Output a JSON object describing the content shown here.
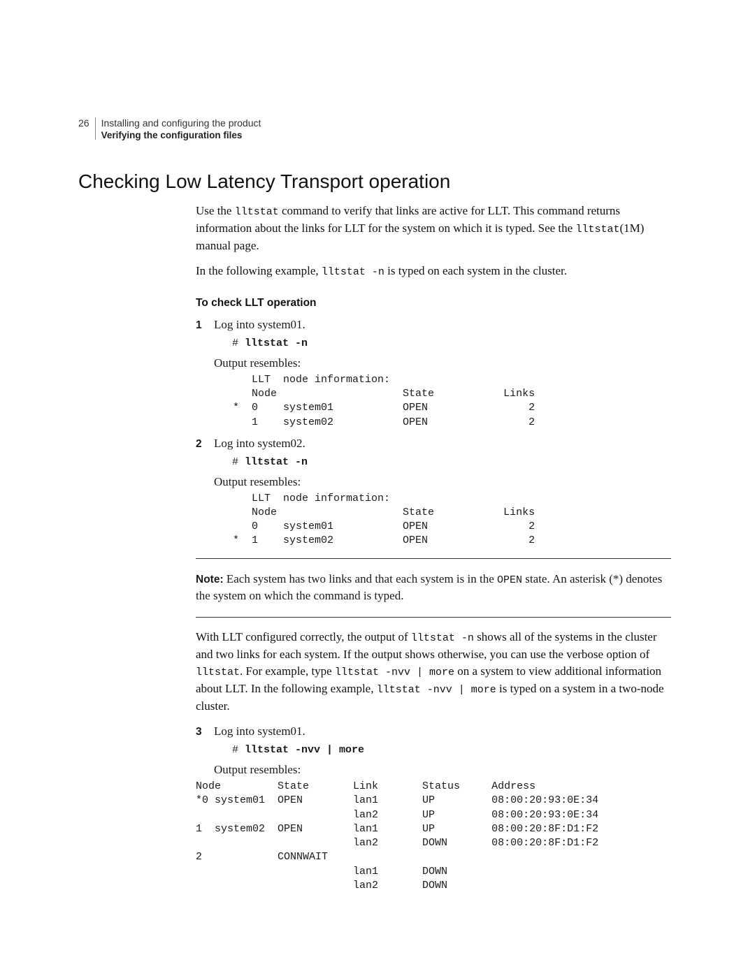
{
  "header": {
    "page_number": "26",
    "line1": "Installing and configuring the product",
    "line2": "Verifying the configuration files"
  },
  "section_title": "Checking Low Latency Transport operation",
  "intro_para_pre": "Use the ",
  "intro_cmd1": "lltstat",
  "intro_para_mid": " command to verify that links are active for LLT. This command returns information about the links for LLT for the system on which it is typed. See the ",
  "intro_cmd2": "lltstat",
  "intro_para_post": "(1M) manual page.",
  "intro2_pre": "In the following example, ",
  "intro2_cmd": "lltstat -n",
  "intro2_post": " is typed on each system in the cluster.",
  "subhead": "To check LLT operation",
  "steps": {
    "s1_num": "1",
    "s1_text": "Log into system01.",
    "s1_hash": "# ",
    "s1_cmd": "lltstat -n",
    "s1_output_label": "Output resembles:",
    "s1_output": "      LLT  node information:\n      Node                    State           Links\n   *  0    system01           OPEN                2\n      1    system02           OPEN                2",
    "s2_num": "2",
    "s2_text": "Log into system02.",
    "s2_hash": "# ",
    "s2_cmd": "lltstat -n",
    "s2_output_label": "Output resembles:",
    "s2_output": "      LLT  node information:\n      Node                    State           Links\n      0    system01           OPEN                2\n   *  1    system02           OPEN                2",
    "s3_num": "3",
    "s3_text": "Log into system01.",
    "s3_hash": "# ",
    "s3_cmd": "lltstat -nvv | more",
    "s3_output_label": "Output resembles:",
    "s3_output": "Node         State       Link       Status     Address\n*0 system01  OPEN        lan1       UP         08:00:20:93:0E:34\n                         lan2       UP         08:00:20:93:0E:34\n1  system02  OPEN        lan1       UP         08:00:20:8F:D1:F2\n                         lan2       DOWN       08:00:20:8F:D1:F2\n2            CONNWAIT\n                         lan1       DOWN\n                         lan2       DOWN"
  },
  "note_lead": "Note:",
  "note_text_pre": " Each system has two links and that each system is in the ",
  "note_open": "OPEN",
  "note_text_post": " state. An asterisk (*) denotes the system on which the command is typed.",
  "para_after_note_pre": "With LLT configured correctly, the output of ",
  "pan_cmd1": "lltstat -n",
  "pan_mid1": " shows all of the systems in the cluster and two links for each system. If the output shows otherwise, you can use the verbose option of ",
  "pan_cmd2": "lltstat",
  "pan_mid2": ". For example, type ",
  "pan_cmd3": "lltstat -nvv | more",
  "pan_mid3": " on a system to view additional information about LLT. In the following example, ",
  "pan_cmd4": "lltstat -nvv | more",
  "pan_post": " is typed on a system in a two-node cluster."
}
